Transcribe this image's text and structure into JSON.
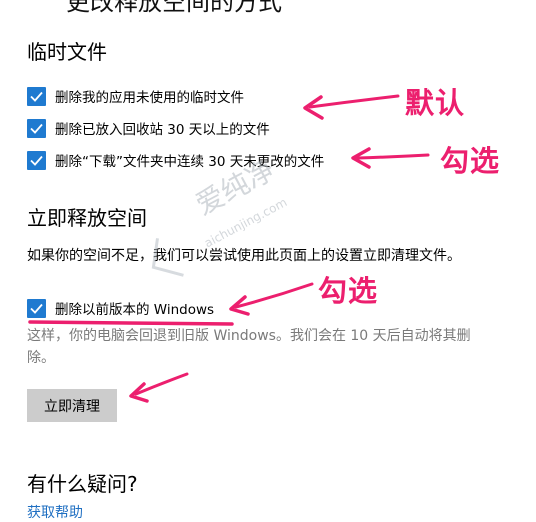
{
  "page": {
    "top_title": "更改释放空间的方式"
  },
  "temp_files": {
    "heading": "临时文件",
    "options": [
      {
        "label": "删除我的应用未使用的临时文件",
        "checked": true
      },
      {
        "label": "删除已放入回收站 30 天以上的文件",
        "checked": true
      },
      {
        "label": "删除“下载”文件夹中连续 30 天未更改的文件",
        "checked": true
      }
    ]
  },
  "free_now": {
    "heading": "立即释放空间",
    "description": "如果你的空间不足，我们可以尝试使用此页面上的设置立即清理文件。",
    "option": {
      "label": "删除以前版本的 Windows",
      "checked": true
    },
    "note": "这样，你的电脑会回退到旧版 Windows。我们会在 10 天后自动将其删除。",
    "button_label": "立即清理"
  },
  "help": {
    "heading": "有什么疑问?",
    "link": "获取帮助"
  },
  "annotations": {
    "default_label": "默认",
    "check_label_1": "勾选",
    "check_label_2": "勾选",
    "color": "#ec1f6e"
  },
  "watermark": {
    "text_cn": "爱纯净",
    "text_url": "aichunjing.com"
  },
  "colors": {
    "checkbox": "#1f7ad0",
    "button": "#cccccc",
    "link": "#1f6fc2"
  }
}
